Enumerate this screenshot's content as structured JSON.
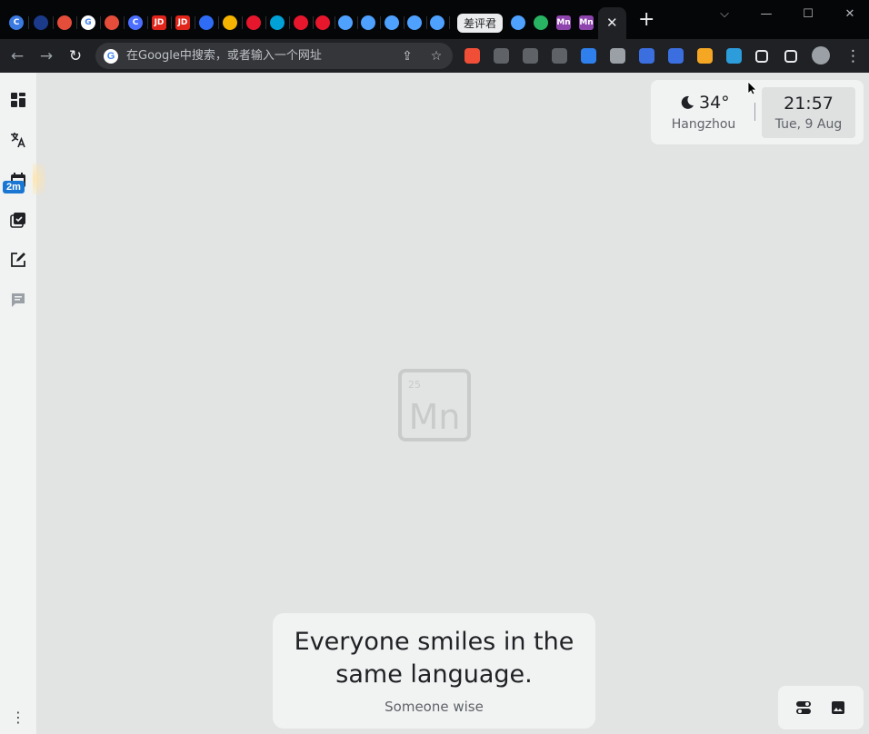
{
  "browser": {
    "tabs": [
      {
        "icon": "circle-c-icon",
        "color": "#3b7ae0",
        "glyph": "C"
      },
      {
        "icon": "circle-dark-icon",
        "color": "#1b3a8a",
        "glyph": ""
      },
      {
        "icon": "shop-icon",
        "color": "#e44d3a",
        "glyph": ""
      },
      {
        "icon": "google-icon",
        "color": "#ffffff",
        "glyph": "G"
      },
      {
        "icon": "shop-icon",
        "color": "#e44d3a",
        "glyph": ""
      },
      {
        "icon": "circle-c-icon",
        "color": "#4c6fff",
        "glyph": "C"
      },
      {
        "icon": "jd-icon",
        "color": "#e1251b",
        "glyph": "JD"
      },
      {
        "icon": "jd-icon",
        "color": "#e1251b",
        "glyph": "JD"
      },
      {
        "icon": "circle-blue-icon",
        "color": "#2e6cf6",
        "glyph": ""
      },
      {
        "icon": "square-yellow-icon",
        "color": "#f5b400",
        "glyph": ""
      },
      {
        "icon": "weibo-icon",
        "color": "#e6162d",
        "glyph": ""
      },
      {
        "icon": "bilibili-icon",
        "color": "#00a1d6",
        "glyph": ""
      },
      {
        "icon": "weibo-icon",
        "color": "#e6162d",
        "glyph": ""
      },
      {
        "icon": "weibo-icon",
        "color": "#e6162d",
        "glyph": ""
      },
      {
        "icon": "robot-icon",
        "color": "#4ea1ff",
        "glyph": ""
      },
      {
        "icon": "robot-icon",
        "color": "#4ea1ff",
        "glyph": ""
      },
      {
        "icon": "robot-icon",
        "color": "#4ea1ff",
        "glyph": ""
      },
      {
        "icon": "robot-icon",
        "color": "#4ea1ff",
        "glyph": ""
      },
      {
        "icon": "robot-icon",
        "color": "#4ea1ff",
        "glyph": ""
      }
    ],
    "text_tab_label": "差评君",
    "tabs_after": [
      {
        "icon": "robot-icon",
        "color": "#4ea1ff",
        "glyph": ""
      },
      {
        "icon": "refresh-green-icon",
        "color": "#28b463",
        "glyph": ""
      },
      {
        "icon": "mn-icon",
        "color": "#8e44ad",
        "glyph": "Mn"
      },
      {
        "icon": "mn-icon",
        "color": "#8e44ad",
        "glyph": "Mn"
      }
    ],
    "active_tab_close": "✕",
    "new_tab": "+",
    "window_controls": {
      "dropdown": "⌵",
      "minimize": "—",
      "maximize": "☐",
      "close": "✕"
    },
    "nav": {
      "back": "←",
      "forward": "→",
      "reload": "↻"
    },
    "omnibox_placeholder": "在Google中搜索，或者输入一个网址",
    "omnibox_icons": {
      "share": "⇪",
      "star": "☆"
    },
    "extensions": [
      {
        "name": "ext-red-icon",
        "color": "#f04e37"
      },
      {
        "name": "ext-flower-icon",
        "color": "#5f6368"
      },
      {
        "name": "ext-glasses-icon",
        "color": "#5f6368"
      },
      {
        "name": "ext-cloud-icon",
        "color": "#5f6368"
      },
      {
        "name": "ext-b-icon",
        "color": "#2f80ed"
      },
      {
        "name": "ext-shield-icon",
        "color": "#9aa0a6"
      },
      {
        "name": "ext-calendar-icon",
        "color": "#3b6fe0"
      },
      {
        "name": "ext-docs-icon",
        "color": "#3b6fe0"
      },
      {
        "name": "ext-orange-icon",
        "color": "#f5a623"
      },
      {
        "name": "ext-diamond-icon",
        "color": "#2d9cdb"
      },
      {
        "name": "extensions-puzzle-icon",
        "color": "#e8eaed"
      },
      {
        "name": "side-panel-icon",
        "color": "#e8eaed"
      },
      {
        "name": "profile-avatar-icon",
        "color": "#9aa0a6"
      }
    ],
    "menu": "⋮"
  },
  "sidebar": {
    "items": [
      {
        "name": "dashboard-icon"
      },
      {
        "name": "translate-icon"
      },
      {
        "name": "calendar-icon"
      },
      {
        "name": "tasks-icon"
      },
      {
        "name": "note-edit-icon"
      },
      {
        "name": "chat-icon"
      }
    ],
    "badge": "2m",
    "more": "⋮"
  },
  "widget": {
    "temperature": "34°",
    "city": "Hangzhou",
    "time": "21:57",
    "date": "Tue, 9 Aug"
  },
  "logo": {
    "number": "25",
    "symbol": "Mn"
  },
  "quote": {
    "text": "Everyone smiles in the same language.",
    "author": "Someone wise"
  },
  "bottom_controls": [
    {
      "name": "settings-toggle-icon"
    },
    {
      "name": "background-image-icon"
    }
  ],
  "colors": {
    "page_bg": "#e2e3e3",
    "card_bg": "#f1f3f3",
    "tabstrip_bg": "#050608",
    "toolbar_bg": "#1f2125",
    "accent_badge": "#1976d2"
  }
}
